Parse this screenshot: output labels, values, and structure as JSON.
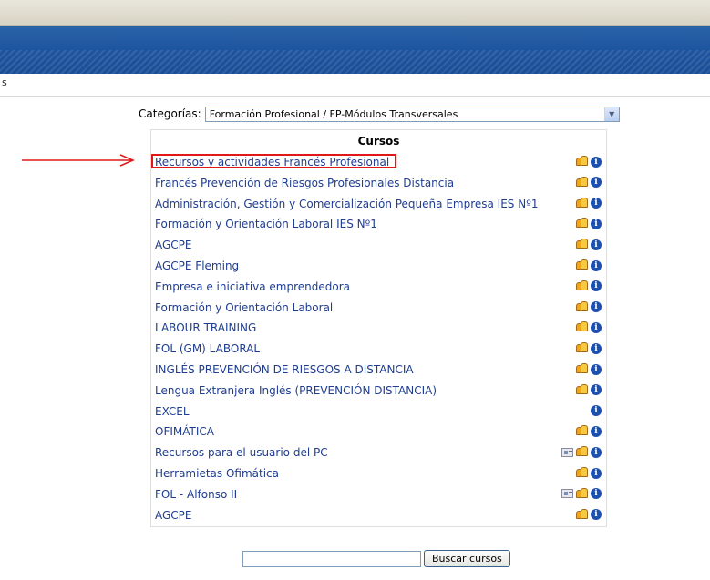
{
  "breadcrumb": "s",
  "categories": {
    "label": "Categorías:",
    "selected": "Formación Profesional / FP-Módulos Transversales"
  },
  "courses": {
    "header": "Cursos",
    "items": [
      {
        "name": "Recursos y actividades Francés Profesional",
        "icons": [
          "guest",
          "info"
        ]
      },
      {
        "name": "Francés Prevención de Riesgos Profesionales Distancia",
        "icons": [
          "guest",
          "info"
        ]
      },
      {
        "name": "Administración, Gestión y Comercialización Pequeña Empresa IES Nº1",
        "icons": [
          "guest",
          "info"
        ]
      },
      {
        "name": "Formación y Orientación Laboral IES Nº1",
        "icons": [
          "guest",
          "info"
        ]
      },
      {
        "name": "AGCPE",
        "icons": [
          "guest",
          "info"
        ]
      },
      {
        "name": "AGCPE Fleming",
        "icons": [
          "guest",
          "info"
        ]
      },
      {
        "name": "Empresa e iniciativa emprendedora",
        "icons": [
          "guest",
          "info"
        ]
      },
      {
        "name": "Formación y Orientación Laboral",
        "icons": [
          "guest",
          "info"
        ]
      },
      {
        "name": "LABOUR TRAINING",
        "icons": [
          "guest",
          "info"
        ]
      },
      {
        "name": "FOL (GM) LABORAL",
        "icons": [
          "guest",
          "info"
        ]
      },
      {
        "name": "INGLÉS PREVENCIÓN DE RIESGOS A DISTANCIA",
        "icons": [
          "guest",
          "info"
        ]
      },
      {
        "name": "Lengua Extranjera Inglés (PREVENCIÓN DISTANCIA)",
        "icons": [
          "guest",
          "info"
        ]
      },
      {
        "name": "EXCEL",
        "icons": [
          "info"
        ]
      },
      {
        "name": "OFIMÁTICA",
        "icons": [
          "guest",
          "info"
        ]
      },
      {
        "name": "Recursos para el usuario del PC",
        "icons": [
          "key",
          "guest",
          "info"
        ]
      },
      {
        "name": "Herramietas Ofimática",
        "icons": [
          "guest",
          "info"
        ]
      },
      {
        "name": "FOL - Alfonso II",
        "icons": [
          "key",
          "guest",
          "info"
        ]
      },
      {
        "name": "AGCPE",
        "icons": [
          "guest",
          "info"
        ]
      }
    ]
  },
  "search": {
    "value": "",
    "button_label": "Buscar cursos"
  },
  "colors": {
    "link": "#1f3d91",
    "banner": "#1f56a0",
    "highlight": "#e01818",
    "info_icon": "#1b4fb0"
  }
}
